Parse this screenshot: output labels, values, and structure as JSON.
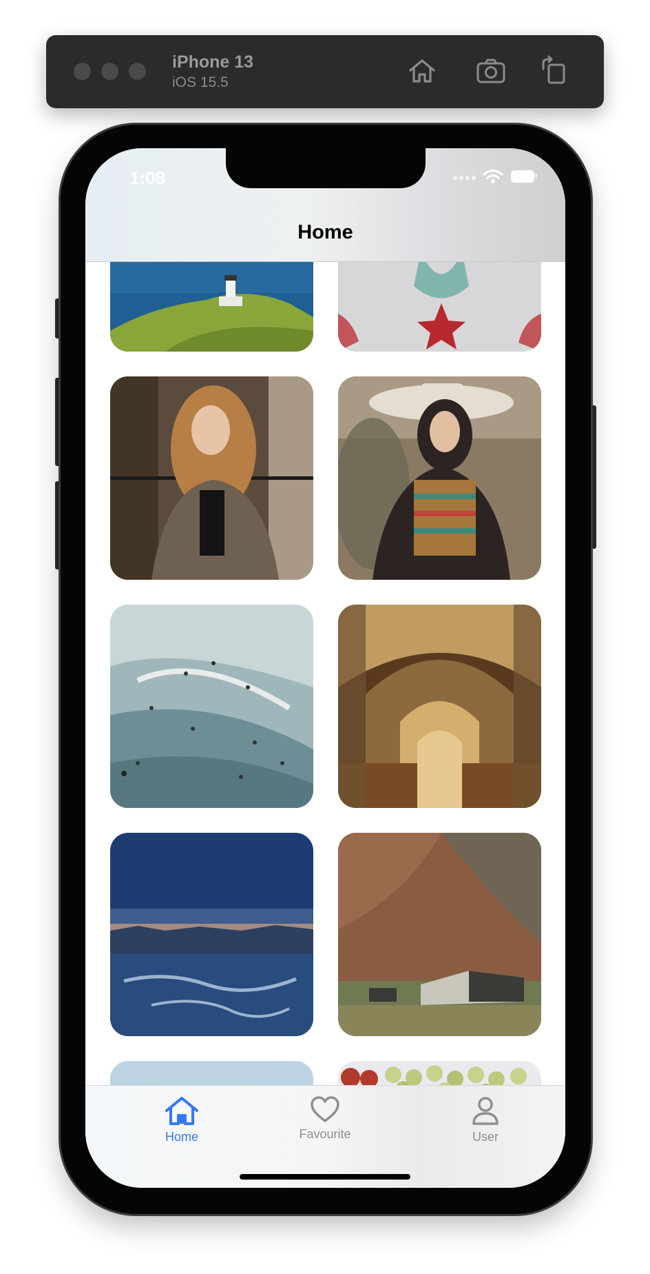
{
  "simulator": {
    "device_name": "iPhone 13",
    "os_version": "iOS 15.5",
    "buttons": [
      "home-icon",
      "camera-icon",
      "rotate-icon"
    ]
  },
  "status_bar": {
    "time": "1:08"
  },
  "nav": {
    "title": "Home"
  },
  "gallery": {
    "tiles": [
      {
        "subject": "lighthouse on coastal cliff",
        "colors": [
          "#1f5f93",
          "#8aa63a"
        ]
      },
      {
        "subject": "person in embroidered white garment",
        "colors": [
          "#d7d7d9",
          "#b8292f"
        ]
      },
      {
        "subject": "woman with curly red hair",
        "colors": [
          "#5a4b3c",
          "#b77f46"
        ]
      },
      {
        "subject": "woman in wide-brim hat",
        "colors": [
          "#8b7a63",
          "#2c2423"
        ]
      },
      {
        "subject": "surfers in ocean waves",
        "colors": [
          "#c9d6d8",
          "#6d8e95"
        ]
      },
      {
        "subject": "ornate cathedral interior",
        "colors": [
          "#c29b63",
          "#5a3a1e"
        ]
      },
      {
        "subject": "blue dusk over frozen lake",
        "colors": [
          "#1c3c72",
          "#274c7d"
        ]
      },
      {
        "subject": "mountain slope with barn",
        "colors": [
          "#8a5c42",
          "#6f7a52"
        ]
      },
      {
        "subject": "pale sky",
        "colors": [
          "#bcd4e2",
          "#cbdde8"
        ]
      },
      {
        "subject": "grapes and berries",
        "colors": [
          "#c7d28a",
          "#b23a2a"
        ]
      }
    ]
  },
  "tabs": [
    {
      "label": "Home",
      "icon": "home-icon",
      "active": true
    },
    {
      "label": "Favourite",
      "icon": "heart-icon",
      "active": false
    },
    {
      "label": "User",
      "icon": "user-icon",
      "active": false
    }
  ],
  "colors": {
    "accent": "#3478f6",
    "inactive": "#8e8e93"
  }
}
